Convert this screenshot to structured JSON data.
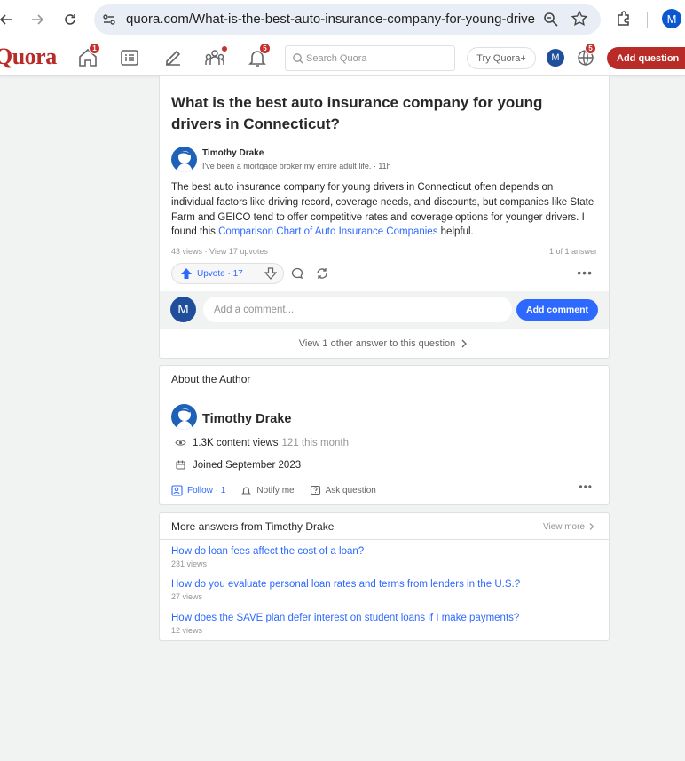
{
  "browser": {
    "url": "quora.com/What-is-the-best-auto-insurance-company-for-young-driver...",
    "profile_initial": "M"
  },
  "header": {
    "logo": "Quora",
    "home_badge": "1",
    "notifications_badge": "5",
    "language_badge": "5",
    "search_placeholder": "Search Quora",
    "try_label": "Try Quora+",
    "avatar_initial": "M",
    "add_question_label": "Add question"
  },
  "question": {
    "title": "What is the best auto insurance company for young drivers in Connecticut?",
    "author": {
      "name": "Timothy Drake",
      "credential": "I've been a mortgage broker my entire adult life. · 11h"
    },
    "answer_text": "The best auto insurance company for young drivers in Connecticut often depends on individual factors like driving record, coverage needs, and discounts, but companies like State Farm and GEICO tend to offer competitive rates and coverage options for younger drivers. I found this ",
    "answer_link": "Comparison Chart of Auto Insurance Companies",
    "answer_tail": " helpful.",
    "stats": "43 views · View 17 upvotes",
    "answer_count": "1 of 1 answer",
    "upvote_label": "Upvote · 17",
    "comment_placeholder": "Add a comment...",
    "comment_avatar_initial": "M",
    "add_comment_label": "Add comment",
    "view_other_label": "View 1 other answer to this question"
  },
  "about": {
    "heading": "About the Author",
    "name": "Timothy Drake",
    "content_views": "1.3K content views",
    "views_this_month": "121 this month",
    "joined": "Joined September 2023",
    "follow_label": "Follow · 1",
    "notify_label": "Notify me",
    "ask_label": "Ask question"
  },
  "more_answers": {
    "heading": "More answers from Timothy Drake",
    "view_more": "View more",
    "items": [
      {
        "question": "How do loan fees affect the cost of a loan?",
        "views": "231 views"
      },
      {
        "question": "How do you evaluate personal loan rates and terms from lenders in the U.S.?",
        "views": "27 views"
      },
      {
        "question": "How does the SAVE plan defer interest on student loans if I make payments?",
        "views": "12 views"
      }
    ]
  },
  "colors": {
    "brand": "#b92b27",
    "link": "#2e69ff",
    "badge": "#c4302b"
  }
}
